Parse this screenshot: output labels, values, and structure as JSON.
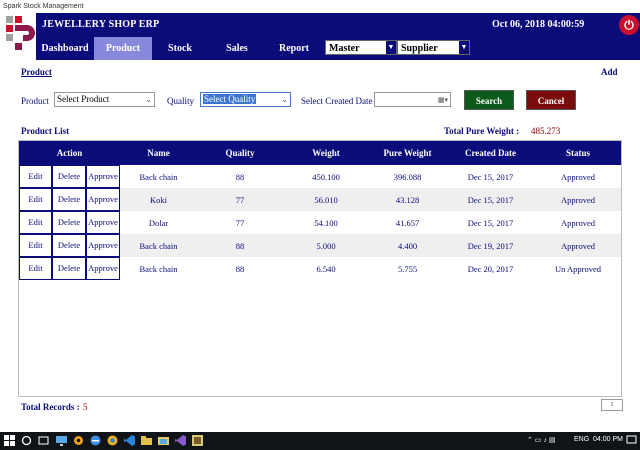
{
  "window_title": "Spark Stock Management",
  "header": {
    "app_name": "JEWELLERY SHOP ERP",
    "datetime": "Oct 06, 2018 04:00:59",
    "colors": {
      "primary": "#0b0b7a",
      "active_tab": "#8888dd",
      "power": "#c8102e"
    }
  },
  "nav": {
    "tabs": [
      {
        "label": "Dashboard",
        "active": false
      },
      {
        "label": "Product",
        "active": true
      },
      {
        "label": "Stock",
        "active": false
      },
      {
        "label": "Sales",
        "active": false
      },
      {
        "label": "Report",
        "active": false
      }
    ],
    "selects": [
      {
        "value": "Master"
      },
      {
        "value": "Supplier"
      }
    ]
  },
  "page": {
    "section_title": "Product",
    "add_label": "Add"
  },
  "filters": {
    "product_label": "Product",
    "product_value": "Select Product",
    "quality_label": "Quality",
    "quality_value": "Select Quality",
    "date_label": "Select Created Date",
    "date_value": "",
    "search_label": "Search",
    "cancel_label": "Cancel"
  },
  "list": {
    "title": "Product List",
    "total_label": "Total Pure  Weight :",
    "total_value": "485.273",
    "columns": [
      "Action",
      "Name",
      "Quality",
      "Weight",
      "Pure Weight",
      "Created Date",
      "Status"
    ],
    "action_labels": {
      "edit": "Edit",
      "delete": "Delete",
      "approve": "Approve"
    },
    "rows": [
      {
        "name": "Back chain",
        "quality": "88",
        "weight": "450.100",
        "pure_weight": "396.088",
        "created": "Dec 15, 2017",
        "status": "Approved"
      },
      {
        "name": "Koki",
        "quality": "77",
        "weight": "56.010",
        "pure_weight": "43.128",
        "created": "Dec 15, 2017",
        "status": "Approved"
      },
      {
        "name": "Dolar",
        "quality": "77",
        "weight": "54.100",
        "pure_weight": "41.657",
        "created": "Dec 15, 2017",
        "status": "Approved"
      },
      {
        "name": "Back chain",
        "quality": "88",
        "weight": "5.000",
        "pure_weight": "4.400",
        "created": "Dec 19, 2017",
        "status": "Approved"
      },
      {
        "name": "Back chain",
        "quality": "88",
        "weight": "6.540",
        "pure_weight": "5.755",
        "created": "Dec 20, 2017",
        "status": "Un Approved"
      }
    ]
  },
  "footer": {
    "records_label": "Total Records :",
    "records_value": "5",
    "pager_label": "1"
  },
  "taskbar": {
    "language": "ENG",
    "time": "04:00 PM"
  }
}
